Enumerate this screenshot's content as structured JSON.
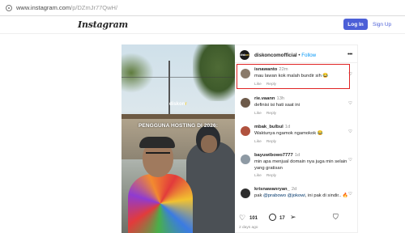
{
  "browser": {
    "url_host": "www.instagram.com",
    "url_path": "/p/DZmJr77QwH/"
  },
  "header": {
    "logo_text": "Instagram",
    "login_label": "Log In",
    "signup_label": "Sign Up",
    "accent_color": "#4c5fd7"
  },
  "media": {
    "brand_left": "diskon",
    "brand_right": "r",
    "caption": "PENGGUNA HOSTING DI 2026:"
  },
  "post": {
    "author": "diskoncomofficial",
    "separator": " • ",
    "follow_label": "Follow",
    "avatar_text_left": "disk",
    "avatar_text_right": "on",
    "likes": "101",
    "comments_count": "17",
    "date": "2 days ago"
  },
  "comments": [
    {
      "user": "isnawanto",
      "time": "22m",
      "text": "mau lawan kok malah bundir sih 😂",
      "like_label": "Like",
      "reply_label": "Reply"
    },
    {
      "user": "rie.vaann",
      "time": "13h",
      "text": "definisi isi hati saat ini",
      "like_label": "Like",
      "reply_label": "Reply"
    },
    {
      "user": "mbak_bulbul",
      "time": "1d",
      "text": "Waktunya ngamok ngamokok 😂",
      "like_label": "Like",
      "reply_label": "Reply"
    },
    {
      "user": "bayuwibowo7777",
      "time": "1d",
      "text": "min apa menjual domain nya juga min selain yang gratisan",
      "like_label": "Like",
      "reply_label": "Reply"
    },
    {
      "user": "krisnawanryan_",
      "time": "2d",
      "text_prefix": "pak ",
      "mention1": "@prabowo",
      "text_mid": " ",
      "mention2": "@jokowi",
      "text_suffix": ", ini pak di sindir.. 🔥",
      "like_label": "Like",
      "reply_label": "Reply"
    }
  ]
}
